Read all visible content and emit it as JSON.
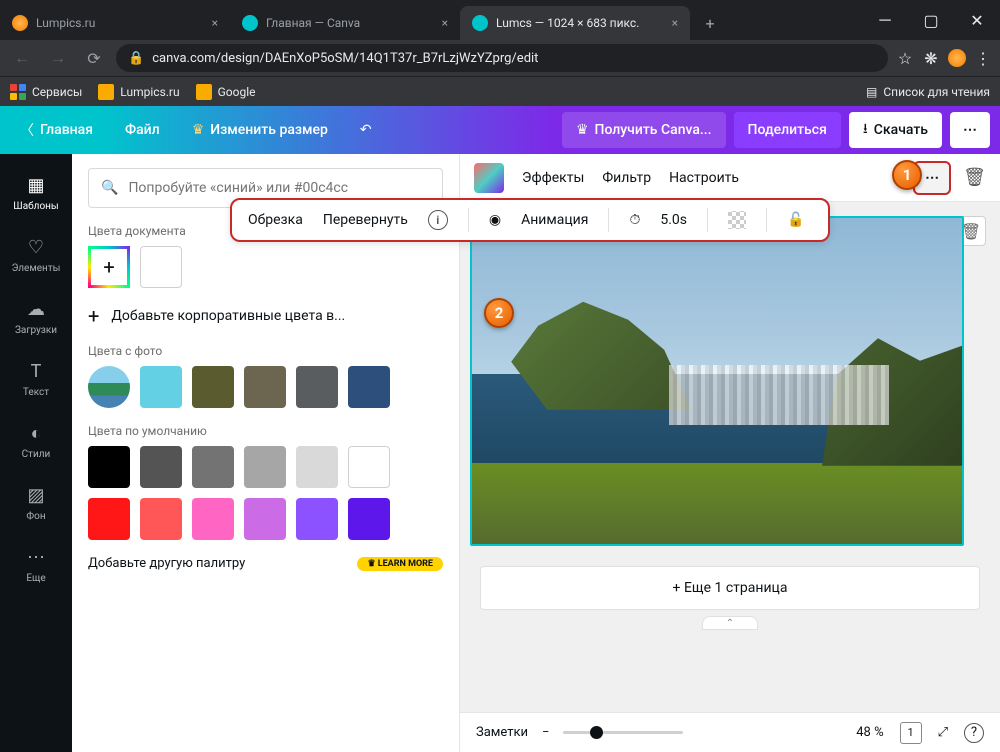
{
  "browser": {
    "tabs": [
      {
        "title": "Lumpics.ru"
      },
      {
        "title": "Главная — Canva"
      },
      {
        "title": "Lumcs — 1024 × 683 пикс."
      }
    ],
    "url": "canva.com/design/DAEnXoP5oSM/14Q1T37r_B7rLzjWzYZprg/edit",
    "bookmarks": {
      "apps": "Сервисы",
      "b1": "Lumpics.ru",
      "b2": "Google",
      "readlist": "Список для чтения"
    }
  },
  "topbar": {
    "home": "Главная",
    "file": "Файл",
    "resize": "Изменить размер",
    "getpro": "Получить Canva...",
    "share": "Поделиться",
    "download": "Скачать"
  },
  "rail": {
    "templates": "Шаблоны",
    "elements": "Элементы",
    "uploads": "Загрузки",
    "text": "Текст",
    "styles": "Стили",
    "bg": "Фон",
    "more": "Еще"
  },
  "panel": {
    "search_placeholder": "Попробуйте «синий» или #00c4cc",
    "doc_colors": "Цвета документа",
    "add_corporate": "Добавьте корпоративные цвета в...",
    "photo_colors": "Цвета с фото",
    "default_colors": "Цвета по умолчанию",
    "add_palette": "Добавьте другую палитру",
    "learn": "LEARN MORE",
    "photo_swatches": [
      "#6d9dc5",
      "#64d0e4",
      "#5a5b2e",
      "#6c6650",
      "#5a5d5f",
      "#2d4f7c"
    ],
    "default_row1": [
      "#000000",
      "#545454",
      "#737373",
      "#a6a6a6",
      "#d9d9d9",
      "#ffffff"
    ],
    "default_row2": [
      "#ff1616",
      "#ff5757",
      "#ff66c4",
      "#cb6ce6",
      "#8c52ff",
      "#5e17eb"
    ]
  },
  "context": {
    "effects": "Эффекты",
    "filter": "Фильтр",
    "adjust": "Настроить"
  },
  "popup": {
    "crop": "Обрезка",
    "flip": "Перевернуть",
    "anim": "Анимация",
    "time": "5.0s"
  },
  "canvas": {
    "add_page": "+ Еще 1 страница"
  },
  "bottom": {
    "notes": "Заметки",
    "zoom": "48 %",
    "page": "1"
  }
}
